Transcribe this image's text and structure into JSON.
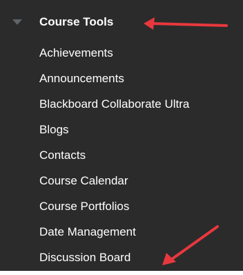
{
  "colors": {
    "panel_background": "#2b2b2b",
    "text": "#ffffff",
    "toggle_icon": "#5f6469",
    "annotation_arrow": "#e8383d"
  },
  "section": {
    "title": "Course Tools",
    "toggle_icon": "triangle-down-icon",
    "expanded": true
  },
  "tools": [
    {
      "label": "Achievements"
    },
    {
      "label": "Announcements"
    },
    {
      "label": "Blackboard Collaborate Ultra"
    },
    {
      "label": "Blogs"
    },
    {
      "label": "Contacts"
    },
    {
      "label": "Course Calendar"
    },
    {
      "label": "Course Portfolios"
    },
    {
      "label": "Date Management"
    },
    {
      "label": "Discussion Board"
    }
  ],
  "annotations": [
    {
      "icon": "red-arrow-icon",
      "points_to": "Course Tools"
    },
    {
      "icon": "red-arrow-icon",
      "points_to": "Discussion Board"
    }
  ]
}
